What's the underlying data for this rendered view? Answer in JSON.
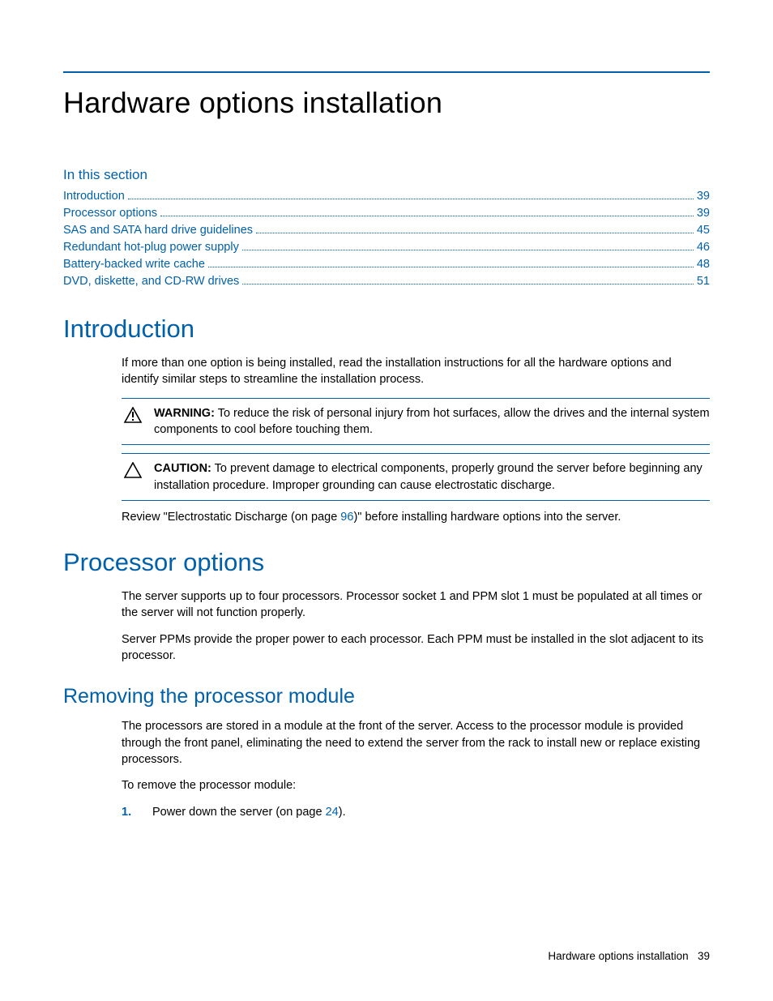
{
  "title": "Hardware options installation",
  "section_label": "In this section",
  "toc": [
    {
      "label": "Introduction",
      "page": "39"
    },
    {
      "label": "Processor options",
      "page": "39"
    },
    {
      "label": "SAS and SATA hard drive guidelines",
      "page": "45"
    },
    {
      "label": "Redundant hot-plug power supply",
      "page": "46"
    },
    {
      "label": "Battery-backed write cache",
      "page": "48"
    },
    {
      "label": "DVD, diskette, and CD-RW drives",
      "page": "51"
    }
  ],
  "introduction": {
    "heading": "Introduction",
    "para1": "If more than one option is being installed, read the installation instructions for all the hardware options and identify similar steps to streamline the installation process.",
    "warning_label": "WARNING:",
    "warning_text": "  To reduce the risk of personal injury from hot surfaces, allow the drives and the internal system components to cool before touching them.",
    "caution_label": "CAUTION:",
    "caution_text": "  To prevent damage to electrical components, properly ground the server before beginning any installation procedure. Improper grounding can cause electrostatic discharge.",
    "review_pre": "Review \"Electrostatic Discharge (on page ",
    "review_link": "96",
    "review_post": ")\" before installing hardware options into the server."
  },
  "processor": {
    "heading": "Processor options",
    "para1": "The server supports up to four processors. Processor socket 1 and PPM slot 1 must be populated at all times or the server will not function properly.",
    "para2": "Server PPMs provide the proper power to each processor. Each PPM must be installed in the slot adjacent to its processor."
  },
  "removing": {
    "heading": "Removing the processor module",
    "para1": "The processors are stored in a module at the front of the server. Access to the processor module is provided through the front panel, eliminating the need to extend the server from the rack to install new or replace existing processors.",
    "para2": "To remove the processor module:",
    "step1_num": "1.",
    "step1_pre": "Power down the server (on page ",
    "step1_link": "24",
    "step1_post": ")."
  },
  "footer": {
    "text": "Hardware options installation",
    "page": "39"
  }
}
